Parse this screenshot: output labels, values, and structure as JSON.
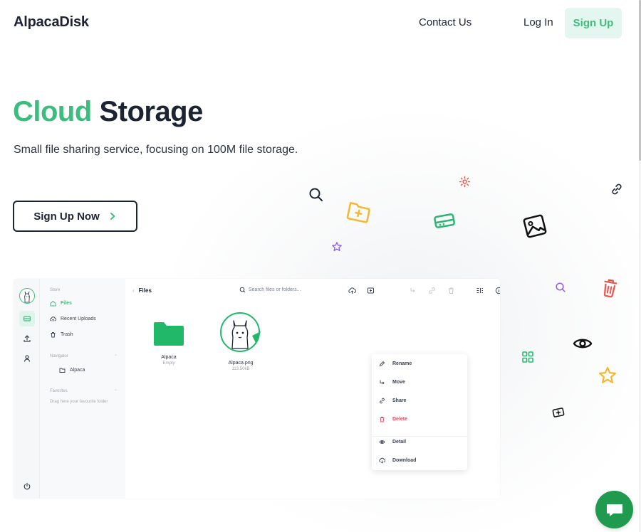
{
  "brand": {
    "name": "AlpacaDisk",
    "accent": "#3dbd7d",
    "dark": "#1c2433"
  },
  "nav": {
    "contact": "Contact Us",
    "login": "Log In",
    "signup": "Sign Up"
  },
  "hero": {
    "title_accent": "Cloud",
    "title_rest": "Storage",
    "subtitle": "Small file sharing service, focusing on 100M file storage.",
    "cta": "Sign Up Now"
  },
  "floating_icons": [
    "search-icon",
    "folder-add-icon",
    "settings-icon",
    "hard-drive-icon",
    "image-icon",
    "link-icon",
    "star-icon",
    "trash-icon",
    "eye-icon",
    "grid-icon",
    "image-add-icon"
  ],
  "preview": {
    "sidebar": {
      "section_store": "Store",
      "items": [
        {
          "label": "Files",
          "icon": "home-icon",
          "active": true
        },
        {
          "label": "Recent Uploads",
          "icon": "cloud-upload-icon",
          "active": false
        },
        {
          "label": "Trash",
          "icon": "trash-icon",
          "active": false
        }
      ],
      "section_navigator": "Navigator",
      "nav_folder": "Alpaca",
      "section_favorites": "Favorites",
      "favorites_hint": "Drag here your favourite folder"
    },
    "toolbar": {
      "breadcrumb": "Files",
      "search_placeholder": "Search files or folders..."
    },
    "files": [
      {
        "name": "Alpaca",
        "meta": "Empty",
        "type": "folder"
      },
      {
        "name": "Alpaca.png",
        "meta": "113.50kB",
        "type": "image"
      }
    ],
    "context_menu": [
      {
        "label": "Rename",
        "icon": "pencil-icon"
      },
      {
        "label": "Move",
        "icon": "move-icon"
      },
      {
        "label": "Share",
        "icon": "link-icon"
      },
      {
        "label": "Delete",
        "icon": "trash-icon",
        "danger": true
      },
      {
        "label": "Detail",
        "icon": "eye-icon"
      },
      {
        "label": "Download",
        "icon": "cloud-download-icon"
      }
    ]
  },
  "chat": {
    "icon": "chat-icon"
  }
}
